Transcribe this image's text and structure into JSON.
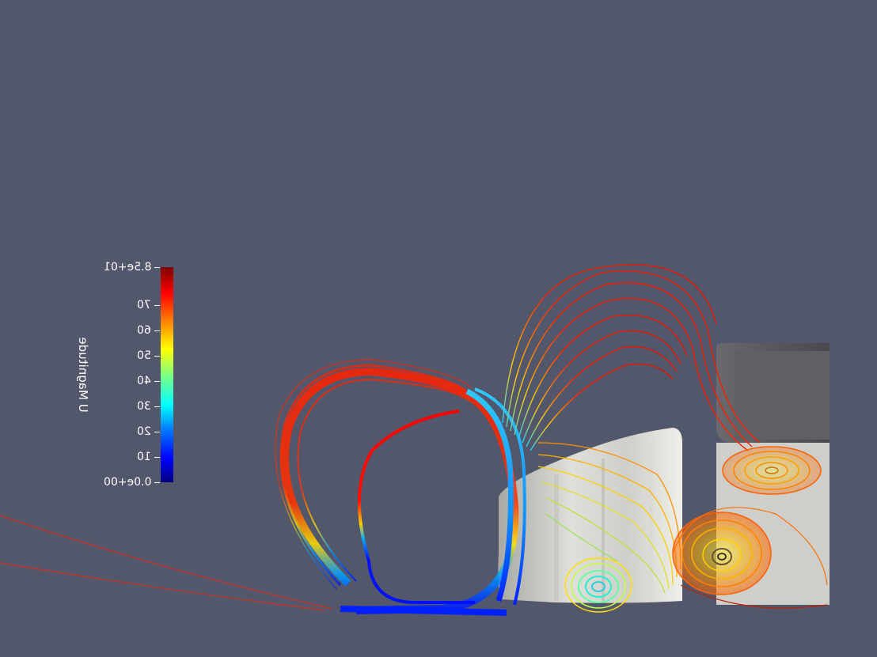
{
  "colorbar": {
    "title": "U Magnitude",
    "min_label": "0.0e+00",
    "max_label": "8.5e+01",
    "range": [
      0,
      85
    ],
    "ticks": [
      {
        "value": 0,
        "label": "0.0e+00"
      },
      {
        "value": 10,
        "label": "10"
      },
      {
        "value": 20,
        "label": "20"
      },
      {
        "value": 30,
        "label": "30"
      },
      {
        "value": 40,
        "label": "40"
      },
      {
        "value": 50,
        "label": "50"
      },
      {
        "value": 60,
        "label": "60"
      },
      {
        "value": 70,
        "label": "70"
      },
      {
        "value": 85,
        "label": "8.5e+01"
      }
    ],
    "colormap": [
      "#00007f",
      "#0000ff",
      "#007fff",
      "#00ffff",
      "#7fff7f",
      "#ffff00",
      "#ff7f00",
      "#ff0000",
      "#7f0000"
    ],
    "orientation": "vertical",
    "mirrored_text": true
  },
  "scene": {
    "background": "#52576b",
    "description_colors": {
      "geometry": "#d8d8d2",
      "rear_block": "#5a5a5e"
    }
  }
}
